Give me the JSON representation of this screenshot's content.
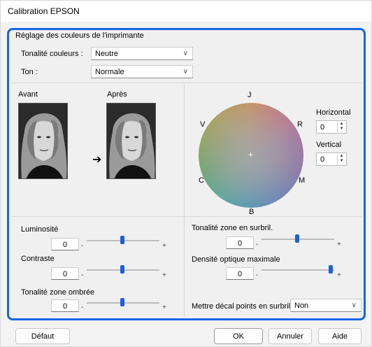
{
  "window": {
    "title": "Calibration EPSON"
  },
  "group": {
    "label": "Réglage des couleurs de l'imprimante"
  },
  "color_tone": {
    "label": "Tonalité couleurs :",
    "value": "Neutre"
  },
  "tone": {
    "label": "Ton :",
    "value": "Normale"
  },
  "preview": {
    "before_label": "Avant",
    "after_label": "Après",
    "arrow": "➔"
  },
  "wheel": {
    "top": "J",
    "right": "R",
    "bottom_right": "M",
    "bottom": "B",
    "left": "C",
    "top_left": "V",
    "center": "+"
  },
  "horizontal": {
    "label": "Horizontal",
    "value": "0"
  },
  "vertical": {
    "label": "Vertical",
    "value": "0"
  },
  "sliders": {
    "brightness": {
      "label": "Luminosité",
      "value": "0",
      "level": 0.5
    },
    "contrast": {
      "label": "Contraste",
      "value": "0",
      "level": 0.5
    },
    "shadow": {
      "label": "Tonalité zone ombrée",
      "value": "0",
      "level": 0.5
    },
    "highlight": {
      "label": "Tonalité zone en surbril.",
      "value": "0",
      "level": 0.5
    },
    "max_density": {
      "label": "Densité optique maximale",
      "value": "0",
      "level": 1.0
    }
  },
  "tick_minus": "-",
  "tick_plus": "+",
  "highlight_points": {
    "label": "Mettre décal points en surbril :",
    "value": "Non"
  },
  "buttons": {
    "default": "Défaut",
    "ok": "OK",
    "cancel": "Annuler",
    "help": "Aide"
  }
}
